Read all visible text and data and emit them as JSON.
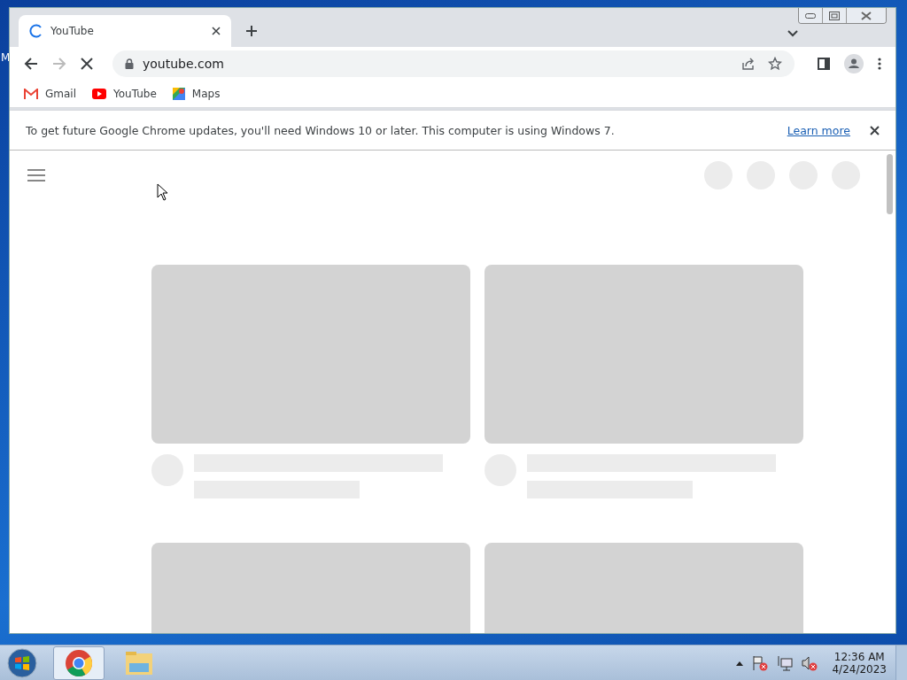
{
  "desktop": {
    "icon_label": "M"
  },
  "window": {
    "tabs": [
      {
        "title": "YouTube",
        "selected": true,
        "loading": true
      }
    ],
    "address": "youtube.com",
    "bookmarks": [
      {
        "kind": "gmail",
        "label": "Gmail"
      },
      {
        "kind": "youtube",
        "label": "YouTube"
      },
      {
        "kind": "maps",
        "label": "Maps"
      }
    ],
    "infobar": {
      "message": "To get future Google Chrome updates, you'll need Windows 10 or later. This computer is using Windows 7.",
      "link": "Learn more"
    },
    "page": {
      "video_placeholders": [
        {
          "kind": "card"
        },
        {
          "kind": "card"
        },
        {
          "kind": "thumbnail"
        },
        {
          "kind": "thumbnail"
        }
      ]
    }
  },
  "taskbar": {
    "apps": [
      {
        "kind": "chrome",
        "selected": true
      },
      {
        "kind": "explorer",
        "selected": false
      }
    ],
    "time": "12:36 AM",
    "date": "4/24/2023"
  }
}
